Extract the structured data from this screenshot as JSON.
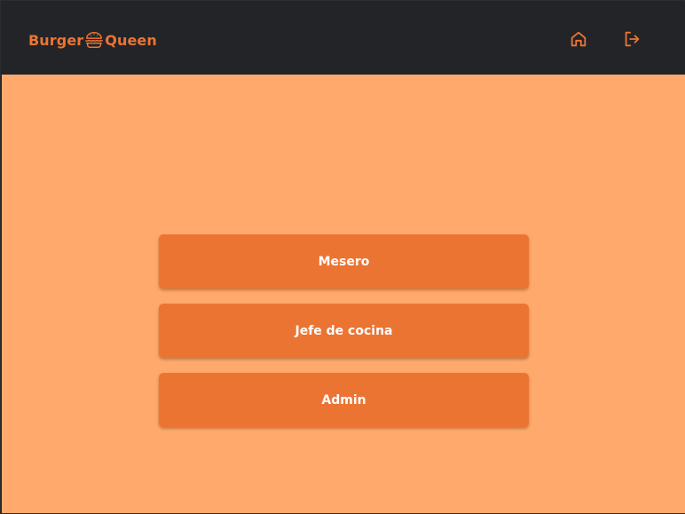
{
  "header": {
    "brand_left": "Burger",
    "brand_right": "Queen",
    "logo_icon": "burger-icon",
    "home_icon": "home-icon",
    "logout_icon": "logout-icon"
  },
  "roles": {
    "items": [
      {
        "label": "Mesero"
      },
      {
        "label": "Jefe de cocina"
      },
      {
        "label": "Admin"
      }
    ]
  },
  "colors": {
    "header_bg": "#222428",
    "accent": "#ec7433",
    "content_bg": "#ffaa6c",
    "button_text": "#ffffff"
  }
}
